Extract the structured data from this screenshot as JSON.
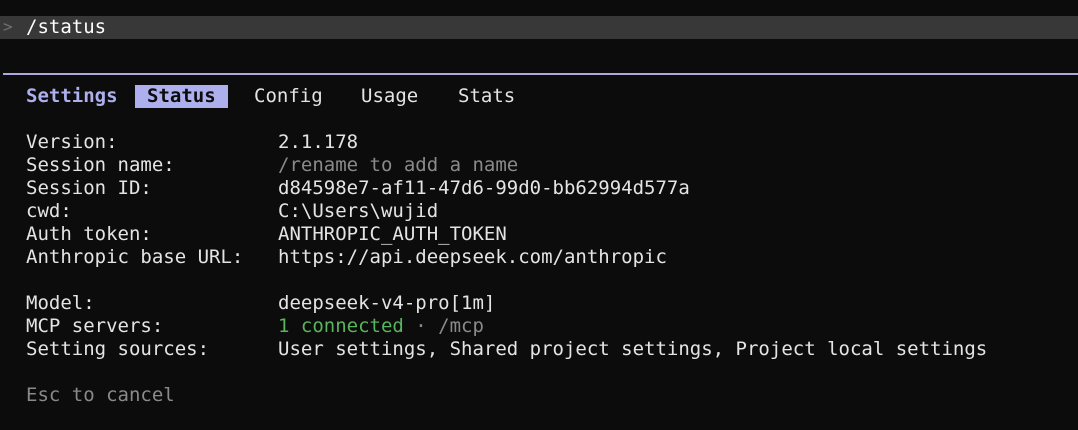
{
  "prompt": {
    "marker": ">",
    "command": "/status"
  },
  "tabs": {
    "heading": "Settings",
    "items": [
      {
        "label": "Status",
        "active": true
      },
      {
        "label": "Config",
        "active": false
      },
      {
        "label": "Usage",
        "active": false
      },
      {
        "label": "Stats",
        "active": false
      }
    ]
  },
  "status": {
    "rows": [
      {
        "key": "Version:",
        "value": "2.1.178"
      },
      {
        "key": "Session name:",
        "value": "/rename to add a name"
      },
      {
        "key": "Session ID:",
        "value": "d84598e7-af11-47d6-99d0-bb62994d577a"
      },
      {
        "key": "cwd:",
        "value": "C:\\Users\\wujid"
      },
      {
        "key": "Auth token:",
        "value": "ANTHROPIC_AUTH_TOKEN"
      },
      {
        "key": "Anthropic base URL:",
        "value": "https://api.deepseek.com/anthropic"
      },
      {
        "key": "Model:",
        "value": "deepseek-v4-pro[1m]"
      },
      {
        "key": "MCP servers:",
        "value_connected": "1 connected",
        "value_rest": " · /mcp"
      },
      {
        "key": "Setting sources:",
        "value": "User settings, Shared project settings, Project local settings"
      }
    ]
  },
  "footer": {
    "hint": "Esc to cancel"
  },
  "colors": {
    "background": "#0c0c0c",
    "accent": "#aeb0ee",
    "connected": "#5ab45a",
    "dim": "#8a8a8a"
  }
}
